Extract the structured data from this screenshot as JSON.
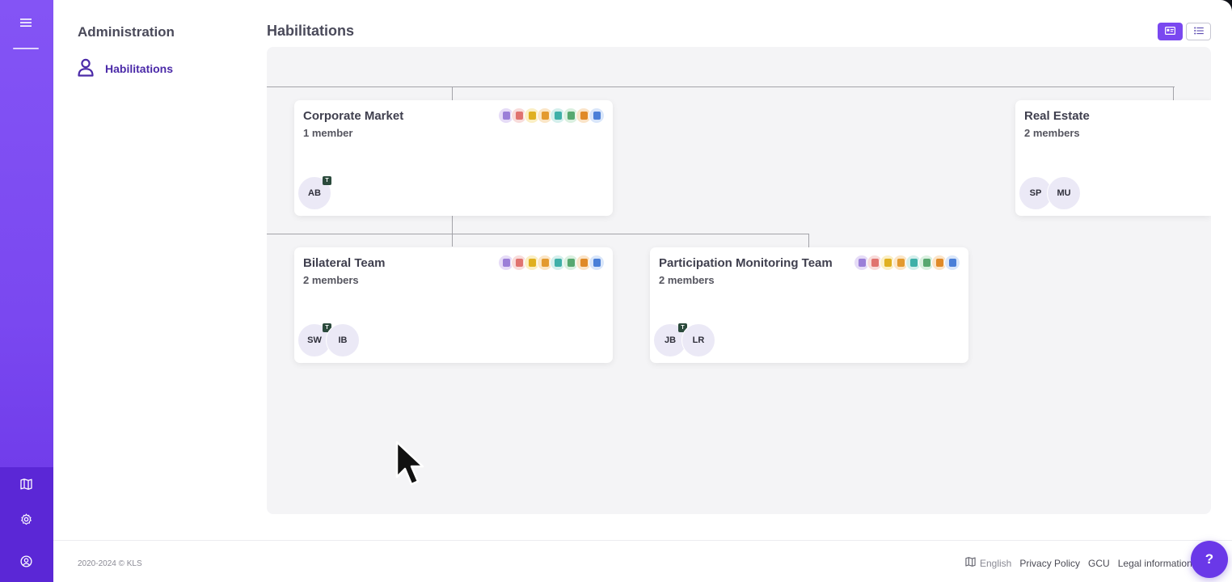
{
  "rail": {
    "icons": [
      "menu-icon",
      "map-icon",
      "gear-icon",
      "user-circle-icon"
    ]
  },
  "sidebar": {
    "title": "Administration",
    "items": [
      {
        "label": "Habilitations",
        "icon": "user-icon",
        "active": true
      }
    ]
  },
  "page": {
    "title": "Habilitations",
    "view_modes": [
      {
        "name": "cards",
        "active": true
      },
      {
        "name": "list",
        "active": false
      }
    ]
  },
  "teams": [
    {
      "name": "Corporate Market",
      "members_label": "1 member",
      "members": [
        {
          "initials": "AB",
          "tag": "T"
        }
      ],
      "show_permissions": true
    },
    {
      "name": "Real Estate",
      "members_label": "2 members",
      "members": [
        {
          "initials": "SP"
        },
        {
          "initials": "MU"
        }
      ],
      "show_permissions": false
    },
    {
      "name": "Bilateral Team",
      "members_label": "2 members",
      "members": [
        {
          "initials": "SW",
          "tag": "T"
        },
        {
          "initials": "IB"
        }
      ],
      "show_permissions": true
    },
    {
      "name": "Participation Monitoring Team",
      "members_label": "2 members",
      "members": [
        {
          "initials": "JB",
          "tag": "T"
        },
        {
          "initials": "LR"
        }
      ],
      "show_permissions": true
    }
  ],
  "permission_icons": [
    {
      "name": "briefcase-icon",
      "color": "#9b7fd8",
      "bg": "#e6dcf7"
    },
    {
      "name": "document-icon",
      "color": "#e0736f",
      "bg": "#f8dcdb"
    },
    {
      "name": "coin-icon",
      "color": "#e0b020",
      "bg": "#fbefc4"
    },
    {
      "name": "handshake-icon",
      "color": "#e39a30",
      "bg": "#fbe6c7"
    },
    {
      "name": "ledger-icon",
      "color": "#3fb0a8",
      "bg": "#d4efec"
    },
    {
      "name": "plant-icon",
      "color": "#58a870",
      "bg": "#daf0e0"
    },
    {
      "name": "storefront-icon",
      "color": "#e08a28",
      "bg": "#fbe4c8"
    },
    {
      "name": "bank-icon",
      "color": "#4a7fd8",
      "bg": "#d9e6fa"
    }
  ],
  "footer": {
    "copyright": "2020-2024 © KLS",
    "language": "English",
    "links": [
      "Privacy Policy",
      "GCU",
      "Legal information"
    ]
  },
  "help": {
    "label": "?"
  }
}
